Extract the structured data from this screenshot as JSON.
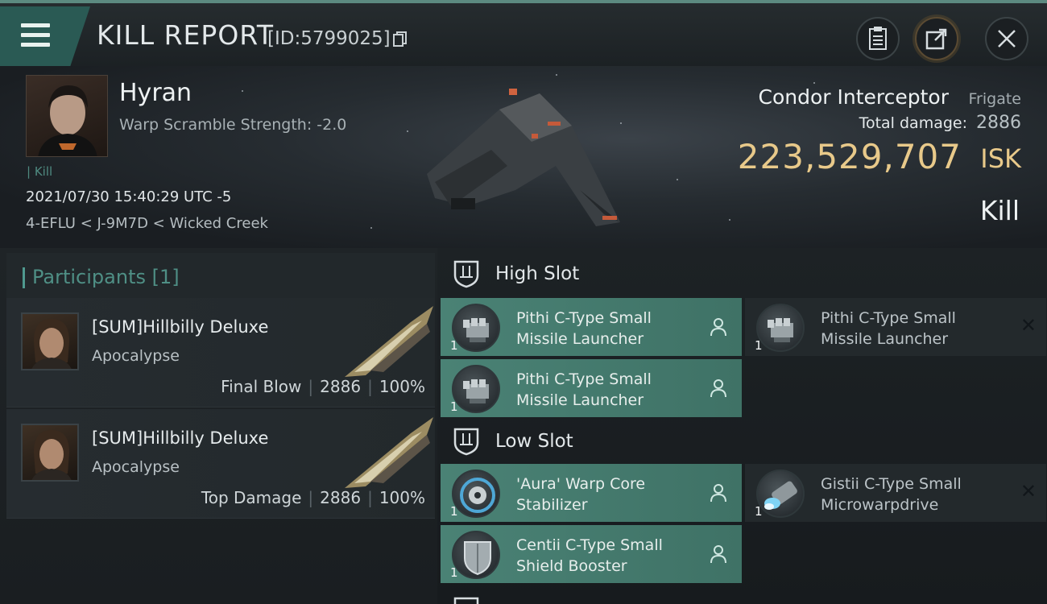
{
  "header": {
    "title": "KILL REPORT",
    "report_id": "[ID:5799025]"
  },
  "victim": {
    "name": "Hyran",
    "warp_scramble": "Warp Scramble Strength: -2.0",
    "tag": "| Kill",
    "datetime": "2021/07/30 15:40:29 UTC -5",
    "location": "4-EFLU < J-9M7D < Wicked Creek"
  },
  "ship": {
    "name": "Condor Interceptor",
    "class": "Frigate",
    "total_damage_label": "Total damage:",
    "total_damage": "2886",
    "isk_value": "223,529,707",
    "isk_unit": "ISK",
    "result": "Kill"
  },
  "participants": {
    "label": "Participants",
    "count": "[1]",
    "rows": [
      {
        "name": "[SUM]Hillbilly Deluxe",
        "ship": "Apocalypse",
        "role": "Final Blow",
        "damage": "2886",
        "percent": "100%"
      },
      {
        "name": "[SUM]Hillbilly Deluxe",
        "ship": "Apocalypse",
        "role": "Top Damage",
        "damage": "2886",
        "percent": "100%"
      }
    ]
  },
  "slots": {
    "high": {
      "label": "High Slot",
      "modules": [
        {
          "name": "Pithi C-Type Small Missile Launcher",
          "qty": "1",
          "state": "fitted"
        },
        {
          "name": "Pithi C-Type Small Missile Launcher",
          "qty": "1",
          "state": "destroyed"
        },
        {
          "name": "Pithi C-Type Small Missile Launcher",
          "qty": "1",
          "state": "fitted"
        }
      ]
    },
    "low": {
      "label": "Low Slot",
      "modules": [
        {
          "name": "'Aura' Warp Core Stabilizer",
          "qty": "1",
          "state": "fitted"
        },
        {
          "name": "Gistii C-Type Small Microwarpdrive",
          "qty": "1",
          "state": "destroyed"
        },
        {
          "name": "Centii C-Type Small Shield Booster",
          "qty": "1",
          "state": "fitted"
        }
      ]
    }
  },
  "icons": {
    "menu": "hamburger-icon",
    "copy": "copy-icon",
    "clipboard": "clipboard-icon",
    "share": "share-icon",
    "close": "close-icon",
    "slot": "slot-shield-icon",
    "pilot": "person-icon",
    "destroyed": "x-icon"
  },
  "colors": {
    "accent_teal": "#4a8275",
    "isk_gold": "#e8c98a",
    "background": "#15191b"
  }
}
